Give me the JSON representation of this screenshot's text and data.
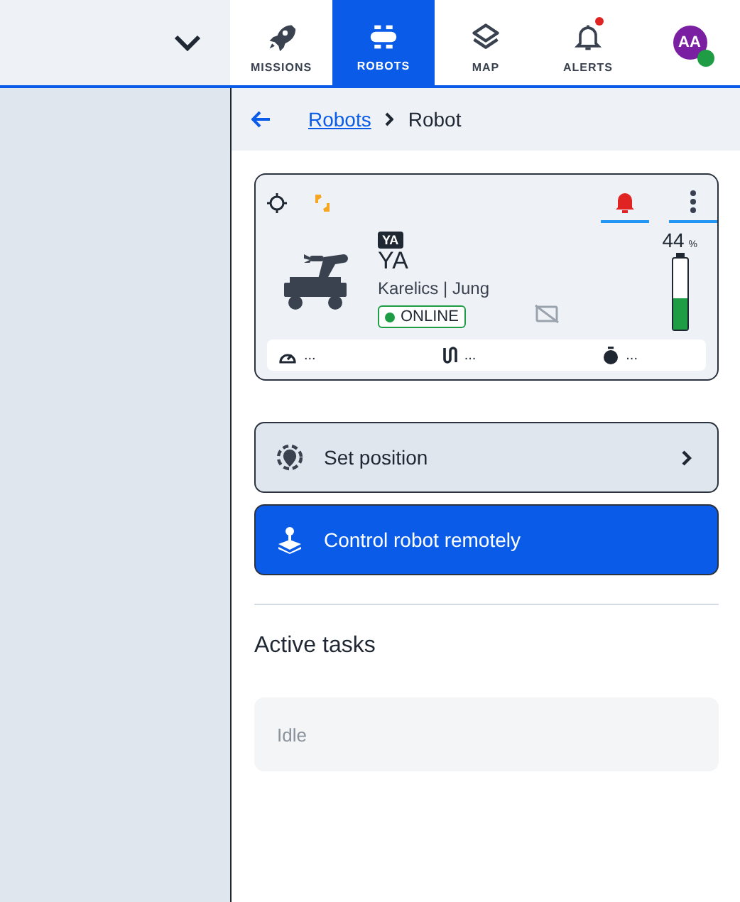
{
  "nav": {
    "items": [
      {
        "kind": "rocket",
        "label": "MISSIONS",
        "selected": false,
        "badge": false
      },
      {
        "kind": "robot",
        "label": "ROBOTS",
        "selected": true,
        "badge": false
      },
      {
        "kind": "layers",
        "label": "MAP",
        "selected": false,
        "badge": false
      },
      {
        "kind": "bell",
        "label": "ALERTS",
        "selected": false,
        "badge": true
      }
    ],
    "avatar": {
      "initials": "AA",
      "online": true
    }
  },
  "breadcrumb": {
    "link": "Robots",
    "current": "Robot"
  },
  "robot_card": {
    "tag": "YA",
    "name": "YA",
    "location": "Karelics | Jung",
    "status": "ONLINE",
    "online": true,
    "battery": "44",
    "battery_unit": "%",
    "level": 0.44,
    "stats": [
      {
        "kind": "speed",
        "value": "..."
      },
      {
        "kind": "path",
        "value": "..."
      },
      {
        "kind": "timer",
        "value": "..."
      }
    ]
  },
  "actions": [
    {
      "kind": "secondary",
      "label": "Set position"
    },
    {
      "kind": "primary",
      "label": "Control robot remotely"
    }
  ],
  "tasks": {
    "heading": "Active tasks",
    "empty": "Idle"
  }
}
